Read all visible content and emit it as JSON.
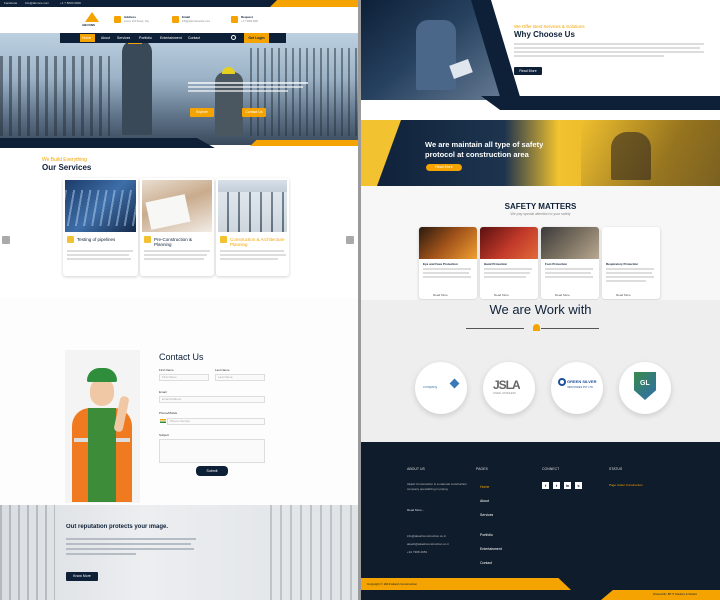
{
  "colors": {
    "navy": "#0e2038",
    "orange": "#f5a300",
    "gold": "#f2c230"
  },
  "left": {
    "topbar": {
      "items": [
        "Facebook",
        "info@abcons.com",
        "+1 7 5000 0000"
      ]
    },
    "logo": {
      "text": "ABCONS"
    },
    "contacts": [
      {
        "label": "Address",
        "value": "Lorem 123 Street, City"
      },
      {
        "label": "Email",
        "value": "info@abconstruction.com"
      },
      {
        "label": "Request",
        "value": "+1 7 5000 0000"
      }
    ],
    "nav": {
      "items": [
        "Home",
        "About",
        "Services",
        "Portfolio",
        "Entertainment",
        "Contact"
      ],
      "cta": "Get Login"
    },
    "hero": {
      "btn1": "Explore",
      "btn2": "Contact Us"
    },
    "services": {
      "tagline": "We Build Everything",
      "title": "Our Services",
      "cards": [
        {
          "title": "Testing of pipelines"
        },
        {
          "title": "Pre-Construction & Planning"
        },
        {
          "title": "Construction & Architecture Planning"
        }
      ]
    },
    "contact": {
      "title": "Contact Us",
      "first_label": "First Name",
      "first_ph": "First Name",
      "last_label": "Last Name",
      "last_ph": "Last Name",
      "email_label": "Email",
      "email_ph": "Email Address",
      "phone_label": "Phone/Mobile",
      "phone_ph": "Phone Number",
      "subject_label": "Subject",
      "submit": "Submit"
    },
    "reputation": {
      "title": "Out reputation protects your image.",
      "btn": "Know More"
    }
  },
  "right": {
    "why": {
      "tagline": "We Offer Best Services & Solutions",
      "title": "Why Choose Us",
      "btn": "Read More"
    },
    "banner": {
      "line1": "We are maintain all type of safety",
      "line2": "protocol at construction area",
      "btn": "Read More"
    },
    "safety": {
      "title": "SAFETY MATTERS",
      "subtitle": "We pay special attention to your safety",
      "cards": [
        {
          "title": "Eye and Face Protection",
          "more": "Read More"
        },
        {
          "title": "Hand Protection",
          "more": "Read More"
        },
        {
          "title": "Foot Protection",
          "more": "Read More"
        },
        {
          "title": "Respiratory Protection",
          "more": "Read More"
        }
      ]
    },
    "work": {
      "title": "We are Work with",
      "logos": [
        "company",
        "JSLA",
        "GREEN SILVER",
        "GL"
      ],
      "jsl_sub": "JINDAL STAINLESS",
      "dsv_sub": "INDUSTRIES PVT LTD"
    },
    "footer": {
      "about_h": "ABOUT US",
      "about_text": "Akash Construction is a national construction company specializing in piping.",
      "about_more": "Read More...",
      "contacts": [
        "info@akashconstruction.co.in",
        "akash@akashconstruction.co.in",
        "+91 7908 4653"
      ],
      "pages_h": "PAGES",
      "pages": [
        "Home",
        "About",
        "Services",
        "Portfolio",
        "Entertainment",
        "Contact"
      ],
      "connect_h": "CONNECT",
      "social": [
        "f",
        "t",
        "in",
        "s"
      ],
      "status_h": "STATUS",
      "status_text": "Page Under Construction",
      "copyright": "Copyright © 2019 Akash Construction",
      "credit": "Powered By: BH IT Solutions & Solution"
    }
  }
}
